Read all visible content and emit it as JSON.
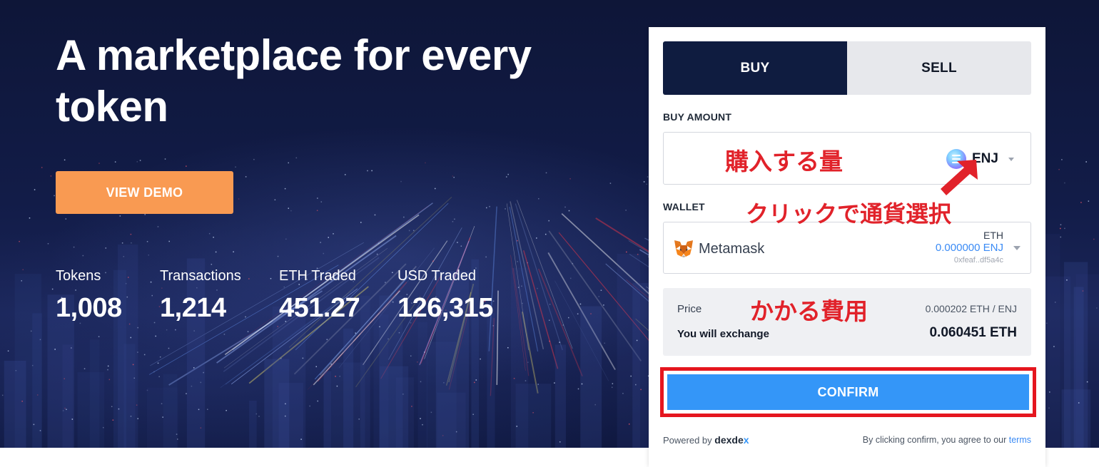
{
  "hero": {
    "title": "A marketplace for every token",
    "demo_label": "VIEW DEMO"
  },
  "stats": [
    {
      "label": "Tokens",
      "value": "1,008"
    },
    {
      "label": "Transactions",
      "value": "1,214"
    },
    {
      "label": "ETH Traded",
      "value": "451.27"
    },
    {
      "label": "USD Traded",
      "value": "126,315"
    }
  ],
  "widget": {
    "tabs": {
      "buy": "BUY",
      "sell": "SELL"
    },
    "buy_amount_label": "BUY AMOUNT",
    "amount_value": "",
    "token": {
      "symbol": "ENJ",
      "icon": "enjin-coin-icon"
    },
    "wallet_label": "WALLET",
    "wallet": {
      "name": "Metamask",
      "icon": "metamask-fox-icon",
      "currency": "ETH",
      "balance": "0.000000 ENJ",
      "address": "0xfeaf..df5a4c"
    },
    "price": {
      "label": "Price",
      "value": "0.000202 ETH / ENJ"
    },
    "exchange": {
      "label": "You will exchange",
      "value": "0.060451 ETH"
    },
    "confirm_label": "CONFIRM",
    "footer": {
      "powered_by": "Powered by",
      "brand_main": "dexde",
      "brand_x": "x",
      "agree_text": "By clicking confirm, you agree to our",
      "terms_link": "terms"
    }
  },
  "annotations": {
    "amount": "購入する量",
    "select_currency": "クリックで通貨選択",
    "cost": "かかる費用"
  },
  "colors": {
    "accent_orange": "#f99a52",
    "confirm_blue": "#3496f8",
    "buy_tab_navy": "#0f1c40",
    "annotation_red": "#e1222a"
  }
}
